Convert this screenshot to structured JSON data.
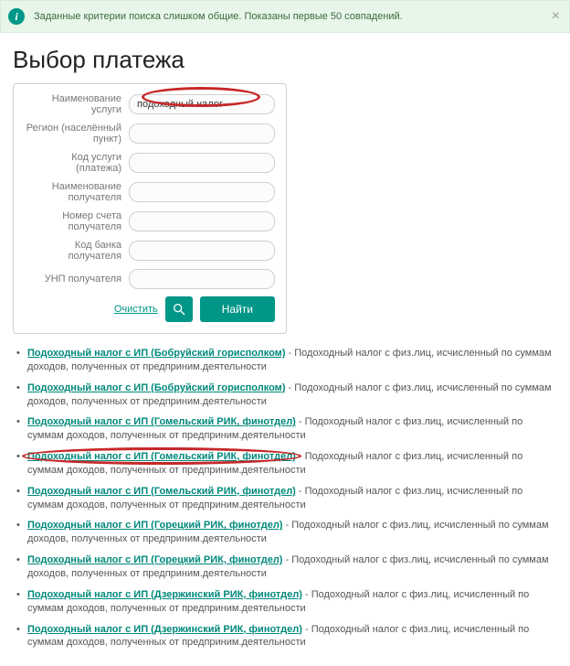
{
  "alert": {
    "text": "Заданные критерии поиска слишком общие. Показаны первые 50 совпадений.",
    "icon_glyph": "i"
  },
  "page_title": "Выбор платежа",
  "form": {
    "labels": {
      "service_name": "Наименование услуги",
      "region": "Регион (населённый пункт)",
      "service_code": "Код услуги (платежа)",
      "recipient_name": "Наименование получателя",
      "recipient_account": "Номер счета получателя",
      "bank_code": "Код банка получателя",
      "recipient_unp": "УНП получателя"
    },
    "values": {
      "service_name": "подоходный налог",
      "region": "",
      "service_code": "",
      "recipient_name": "",
      "recipient_account": "",
      "bank_code": "",
      "recipient_unp": ""
    },
    "buttons": {
      "clear": "Очистить",
      "find": "Найти"
    }
  },
  "results": [
    {
      "link": "Подоходный налог с ИП (Бобруйский горисполком)",
      "desc": "Подоходный налог с физ.лиц, исчисленный по суммам доходов, полученных от предприним.деятельности"
    },
    {
      "link": "Подоходный налог с ИП (Бобруйский горисполком)",
      "desc": "Подоходный налог с физ.лиц, исчисленный по суммам доходов, полученных от предприним.деятельности"
    },
    {
      "link": "Подоходный налог с ИП (Гомельский РИК, финотдел)",
      "desc": "Подоходный налог с физ.лиц, исчисленный по суммам доходов, полученных от предприним.деятельности"
    },
    {
      "link": "Подоходный налог с ИП (Гомельский РИК, финотдел)",
      "desc": "Подоходный налог с физ.лиц, исчисленный по суммам доходов, полученных от предприним.деятельности"
    },
    {
      "link": "Подоходный налог с ИП (Гомельский РИК, финотдел)",
      "desc": "Подоходный налог с физ.лиц, исчисленный по суммам доходов, полученных от предприним.деятельности"
    },
    {
      "link": "Подоходный налог с ИП (Горецкий РИК, финотдел)",
      "desc": "Подоходный налог с физ.лиц, исчисленный по суммам доходов, полученных от предприним.деятельности"
    },
    {
      "link": "Подоходный налог с ИП (Горецкий РИК, финотдел)",
      "desc": "Подоходный налог с физ.лиц, исчисленный по суммам доходов, полученных от предприним.деятельности"
    },
    {
      "link": "Подоходный налог с ИП (Дзержинский РИК, финотдел)",
      "desc": "Подоходный налог с физ.лиц, исчисленный по суммам доходов, полученных от предприним.деятельности"
    },
    {
      "link": "Подоходный налог с ИП (Дзержинский РИК, финотдел)",
      "desc": "Подоходный налог с физ.лиц, исчисленный по суммам доходов, полученных от предприним.деятельности"
    }
  ]
}
